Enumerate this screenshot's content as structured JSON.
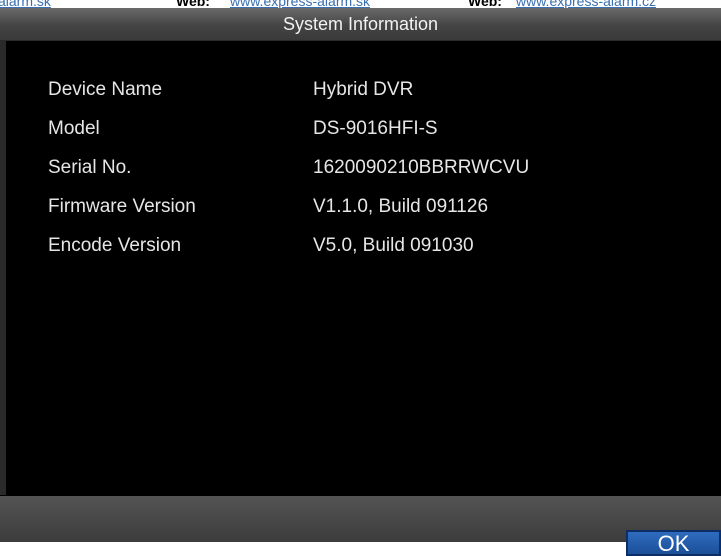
{
  "web_header": {
    "fragment_link_left": "alarm.sk",
    "label_1": "Web:",
    "link_1": "www.express-alarm.sk",
    "label_2": "Web:",
    "link_2": "www.express-alarm.cz"
  },
  "window": {
    "title": "System Information"
  },
  "info": [
    {
      "label": "Device Name",
      "value": "Hybrid DVR"
    },
    {
      "label": "Model",
      "value": "DS-9016HFI-S"
    },
    {
      "label": "Serial No.",
      "value": "1620090210BBRRWCVU"
    },
    {
      "label": "Firmware Version",
      "value": "V1.1.0, Build 091126"
    },
    {
      "label": "Encode Version",
      "value": "V5.0, Build 091030"
    }
  ],
  "footer": {
    "ok_label": "OK"
  },
  "colors": {
    "background": "#000000",
    "title_bar": "#4a4a4a",
    "text": "#e6e6e6",
    "ok_button": "#2560b0",
    "link": "#3a6fb0"
  }
}
